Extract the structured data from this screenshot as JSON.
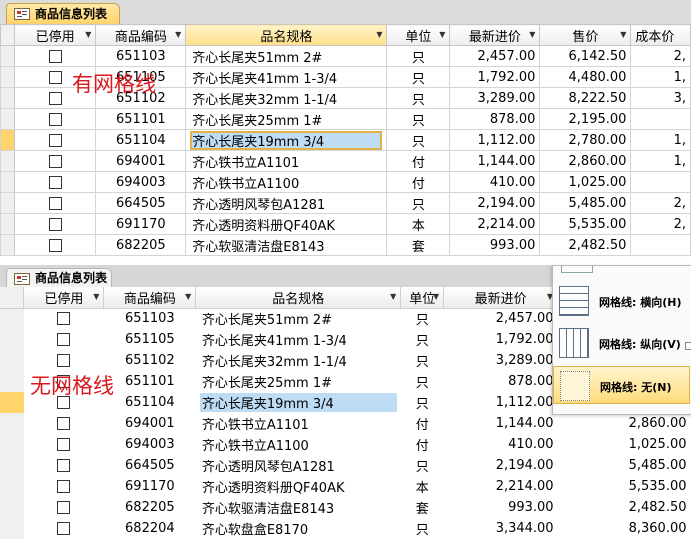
{
  "panel1": {
    "tab_title": "商品信息列表",
    "annotation": "有网格线",
    "headers": [
      "已停用",
      "商品编码",
      "品名规格",
      "单位",
      "最新进价",
      "售价",
      "成本价"
    ],
    "rows": [
      {
        "code": "651103",
        "name": "齐心长尾夹51mm 2#",
        "unit": "只",
        "cost": "2,457.00",
        "price": "6,142.50",
        "extra": "2,"
      },
      {
        "code": "651105",
        "name": "齐心长尾夹41mm 1-3/4",
        "unit": "只",
        "cost": "1,792.00",
        "price": "4,480.00",
        "extra": "1,"
      },
      {
        "code": "651102",
        "name": "齐心长尾夹32mm 1-1/4",
        "unit": "只",
        "cost": "3,289.00",
        "price": "8,222.50",
        "extra": "3,"
      },
      {
        "code": "651101",
        "name": "齐心长尾夹25mm 1#",
        "unit": "只",
        "cost": "878.00",
        "price": "2,195.00",
        "extra": ""
      },
      {
        "code": "651104",
        "name": "齐心长尾夹19mm 3/4",
        "unit": "只",
        "cost": "1,112.00",
        "price": "2,780.00",
        "extra": "1,"
      },
      {
        "code": "694001",
        "name": "齐心铁书立A1101",
        "unit": "付",
        "cost": "1,144.00",
        "price": "2,860.00",
        "extra": "1,"
      },
      {
        "code": "694003",
        "name": "齐心铁书立A1100",
        "unit": "付",
        "cost": "410.00",
        "price": "1,025.00",
        "extra": ""
      },
      {
        "code": "664505",
        "name": "齐心透明风琴包A1281",
        "unit": "只",
        "cost": "2,194.00",
        "price": "5,485.00",
        "extra": "2,"
      },
      {
        "code": "691170",
        "name": "齐心透明资料册QF40AK",
        "unit": "本",
        "cost": "2,214.00",
        "price": "5,535.00",
        "extra": "2,"
      },
      {
        "code": "682205",
        "name": "齐心软驱清洁盘E8143",
        "unit": "套",
        "cost": "993.00",
        "price": "2,482.50",
        "extra": ""
      }
    ]
  },
  "panel2": {
    "tab_title": "商品信息列表",
    "annotation": "无网格线",
    "headers": [
      "已停用",
      "商品编码",
      "品名规格",
      "单位",
      "最新进价"
    ],
    "rows": [
      {
        "code": "651103",
        "name": "齐心长尾夹51mm 2#",
        "unit": "只",
        "cost": "2,457.00",
        "price": ""
      },
      {
        "code": "651105",
        "name": "齐心长尾夹41mm 1-3/4",
        "unit": "只",
        "cost": "1,792.00",
        "price": ""
      },
      {
        "code": "651102",
        "name": "齐心长尾夹32mm 1-1/4",
        "unit": "只",
        "cost": "3,289.00",
        "price": ""
      },
      {
        "code": "651101",
        "name": "齐心长尾夹25mm 1#",
        "unit": "只",
        "cost": "878.00",
        "price": ""
      },
      {
        "code": "651104",
        "name": "齐心长尾夹19mm 3/4",
        "unit": "只",
        "cost": "1,112.00",
        "price": ""
      },
      {
        "code": "694001",
        "name": "齐心铁书立A1101",
        "unit": "付",
        "cost": "1,144.00",
        "price": "2,860.00"
      },
      {
        "code": "694003",
        "name": "齐心铁书立A1100",
        "unit": "付",
        "cost": "410.00",
        "price": "1,025.00"
      },
      {
        "code": "664505",
        "name": "齐心透明风琴包A1281",
        "unit": "只",
        "cost": "2,194.00",
        "price": "5,485.00"
      },
      {
        "code": "691170",
        "name": "齐心透明资料册QF40AK",
        "unit": "本",
        "cost": "2,214.00",
        "price": "5,535.00"
      },
      {
        "code": "682205",
        "name": "齐心软驱清洁盘E8143",
        "unit": "套",
        "cost": "993.00",
        "price": "2,482.50"
      },
      {
        "code": "682204",
        "name": "齐心软盘盒E8170",
        "unit": "只",
        "cost": "3,344.00",
        "price": "8,360.00"
      }
    ]
  },
  "gridlines_menu": {
    "items": [
      {
        "id": "horizontal",
        "label": "网格线: 横向(H)",
        "icon": "gridlines-horizontal-icon"
      },
      {
        "id": "vertical",
        "label": "网格线: 纵向(V)",
        "icon": "gridlines-vertical-icon"
      },
      {
        "id": "none",
        "label": "网格线: 无(N)",
        "icon": "gridlines-none-icon",
        "highlighted": true
      }
    ]
  },
  "colors": {
    "tab_active": "#ffd36a",
    "selection": "#bfdcf5",
    "annotation": "#d8181f",
    "current_row_marker": "#ffd46b"
  }
}
